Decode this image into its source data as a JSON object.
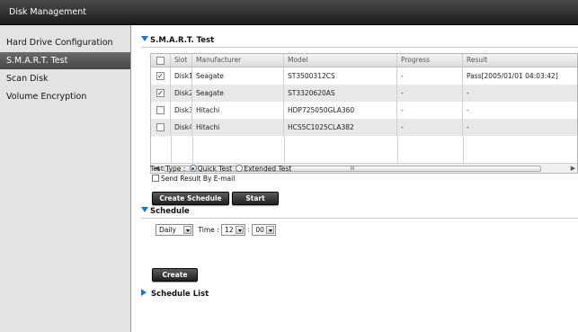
{
  "window": {
    "title": "Disk Management"
  },
  "sidebar": {
    "items": [
      {
        "label": "Hard Drive Configuration",
        "active": false
      },
      {
        "label": "S.M.A.R.T. Test",
        "active": true
      },
      {
        "label": "Scan Disk",
        "active": false
      },
      {
        "label": "Volume Encryption",
        "active": false
      }
    ]
  },
  "smart": {
    "heading": "S.M.A.R.T. Test",
    "columns": [
      "Slot",
      "Manufacturer",
      "Model",
      "Progress",
      "Result"
    ],
    "rows": [
      {
        "checked": true,
        "slot": "Disk1",
        "manufacturer": "Seagate",
        "model": "ST3500312CS",
        "progress": "-",
        "result": "Pass[2005/01/01 04:03:42]"
      },
      {
        "checked": true,
        "slot": "Disk2",
        "manufacturer": "Seagate",
        "model": "ST3320620AS",
        "progress": "-",
        "result": "-"
      },
      {
        "checked": false,
        "slot": "Disk3",
        "manufacturer": "Hitachi",
        "model": "HDP725050GLA360",
        "progress": "-",
        "result": "-"
      },
      {
        "checked": false,
        "slot": "Disk4",
        "manufacturer": "Hitachi",
        "model": "HCS5C1025CLA382",
        "progress": "-",
        "result": "-"
      }
    ],
    "scroll_grip": "III",
    "test_type": {
      "label": "Test Type :",
      "quick": "Quick Test",
      "extended": "Extended Test",
      "selected": "Quick Test"
    },
    "email_label": "Send Result By E-mail",
    "create_schedule_label": "Create Schedule",
    "start_label": "Start"
  },
  "schedule": {
    "heading": "Schedule",
    "frequency": "Daily",
    "time_label": "Time :",
    "hour": "12",
    "separator": ":",
    "minute": "00",
    "create_label": "Create"
  },
  "schedule_list": {
    "heading": "Schedule List"
  },
  "colors": {
    "accent": "#1677d6",
    "active_nav": "#555555",
    "title_bar": "#2a2a2a"
  }
}
